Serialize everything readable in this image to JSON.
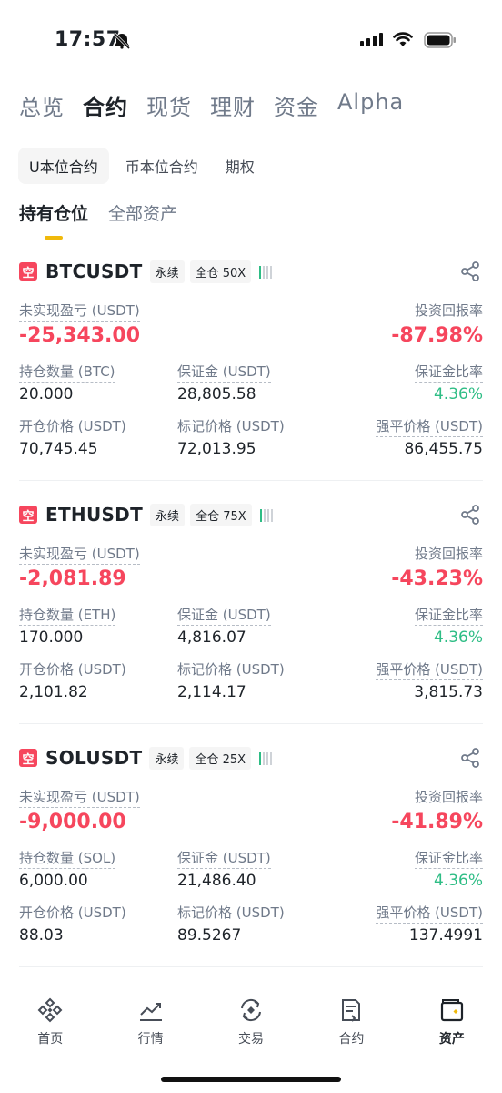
{
  "status_bar": {
    "time": "17:57"
  },
  "top_tabs": [
    {
      "label": "总览",
      "active": false
    },
    {
      "label": "合约",
      "active": true
    },
    {
      "label": "现货",
      "active": false
    },
    {
      "label": "理财",
      "active": false
    },
    {
      "label": "资金",
      "active": false
    },
    {
      "label": "Alpha",
      "active": false
    }
  ],
  "sub_tabs": [
    {
      "label": "U本位合约",
      "active": true
    },
    {
      "label": "币本位合约",
      "active": false
    },
    {
      "label": "期权",
      "active": false
    }
  ],
  "position_tabs": [
    {
      "label": "持有仓位",
      "active": true
    },
    {
      "label": "全部资产",
      "active": false
    }
  ],
  "labels": {
    "unrealized_pnl": "未实现盈亏 (USDT)",
    "roi": "投资回报率",
    "margin": "保证金 (USDT)",
    "margin_ratio": "保证金比率",
    "entry_price": "开仓价格 (USDT)",
    "mark_price": "标记价格 (USDT)",
    "liq_price": "强平价格 (USDT)"
  },
  "positions": [
    {
      "side": "空",
      "symbol": "BTCUSDT",
      "type_tag": "永续",
      "margin_tag": "全仓 50X",
      "pnl": "-25,343.00",
      "roi": "-87.98%",
      "size_label": "持仓数量 (BTC)",
      "size": "20.000",
      "margin": "28,805.58",
      "margin_ratio": "4.36%",
      "entry_price": "70,745.45",
      "mark_price": "72,013.95",
      "liq_price": "86,455.75"
    },
    {
      "side": "空",
      "symbol": "ETHUSDT",
      "type_tag": "永续",
      "margin_tag": "全仓 75X",
      "pnl": "-2,081.89",
      "roi": "-43.23%",
      "size_label": "持仓数量 (ETH)",
      "size": "170.000",
      "margin": "4,816.07",
      "margin_ratio": "4.36%",
      "entry_price": "2,101.82",
      "mark_price": "2,114.17",
      "liq_price": "3,815.73"
    },
    {
      "side": "空",
      "symbol": "SOLUSDT",
      "type_tag": "永续",
      "margin_tag": "全仓 25X",
      "pnl": "-9,000.00",
      "roi": "-41.89%",
      "size_label": "持仓数量 (SOL)",
      "size": "6,000.00",
      "margin": "21,486.40",
      "margin_ratio": "4.36%",
      "entry_price": "88.03",
      "mark_price": "89.5267",
      "liq_price": "137.4991"
    }
  ],
  "bottom_nav": [
    {
      "label": "首页",
      "icon": "home-icon",
      "active": false
    },
    {
      "label": "行情",
      "icon": "markets-icon",
      "active": false
    },
    {
      "label": "交易",
      "icon": "trade-icon",
      "active": false
    },
    {
      "label": "合约",
      "icon": "futures-icon",
      "active": false
    },
    {
      "label": "资产",
      "icon": "wallet-icon",
      "active": true
    }
  ],
  "colors": {
    "loss": "#f6465d",
    "profit": "#2ebd85",
    "accent": "#f0b90b",
    "text_primary": "#1e2329",
    "text_secondary": "#707a8a"
  }
}
